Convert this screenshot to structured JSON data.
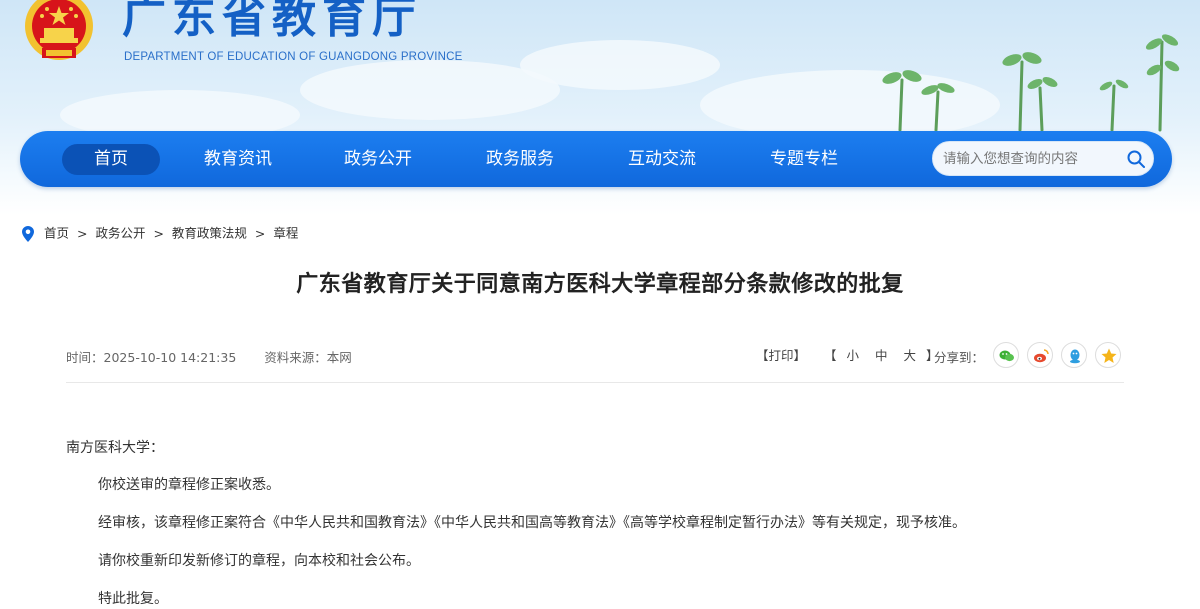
{
  "header": {
    "site_title": "广东省教育厅",
    "site_subtitle": "DEPARTMENT OF EDUCATION OF GUANGDONG PROVINCE"
  },
  "nav": {
    "items": [
      "首页",
      "教育资讯",
      "政务公开",
      "政务服务",
      "互动交流",
      "专题专栏"
    ],
    "active": "首页",
    "search_placeholder": "请输入您想查询的内容"
  },
  "breadcrumb": [
    "首页",
    "政务公开",
    "教育政策法规",
    "章程"
  ],
  "article": {
    "title": "广东省教育厅关于同意南方医科大学章程部分条款修改的批复",
    "time_label": "时间：",
    "time": "2025-10-10 14:21:35",
    "source_label": "资料来源：",
    "source": "本网",
    "print": "【打印】",
    "font_size": {
      "open": "【",
      "small": "小",
      "medium": "中",
      "large": "大",
      "close": "】"
    },
    "share_label": "分享到：",
    "salutation": "南方医科大学：",
    "paragraphs": [
      "你校送审的章程修正案收悉。",
      "经审核，该章程修正案符合《中华人民共和国教育法》《中华人民共和国高等教育法》《高等学校章程制定暂行办法》等有关规定，现予核准。",
      "请你校重新印发新修订的章程，向本校和社会公布。",
      "特此批复。"
    ]
  },
  "share_icons": [
    "wechat-icon",
    "weibo-icon",
    "qq-icon",
    "qzone-icon"
  ],
  "colors": {
    "brand_blue": "#1068dc",
    "active_nav": "#0b52b6",
    "title_blue": "#1460c5"
  }
}
